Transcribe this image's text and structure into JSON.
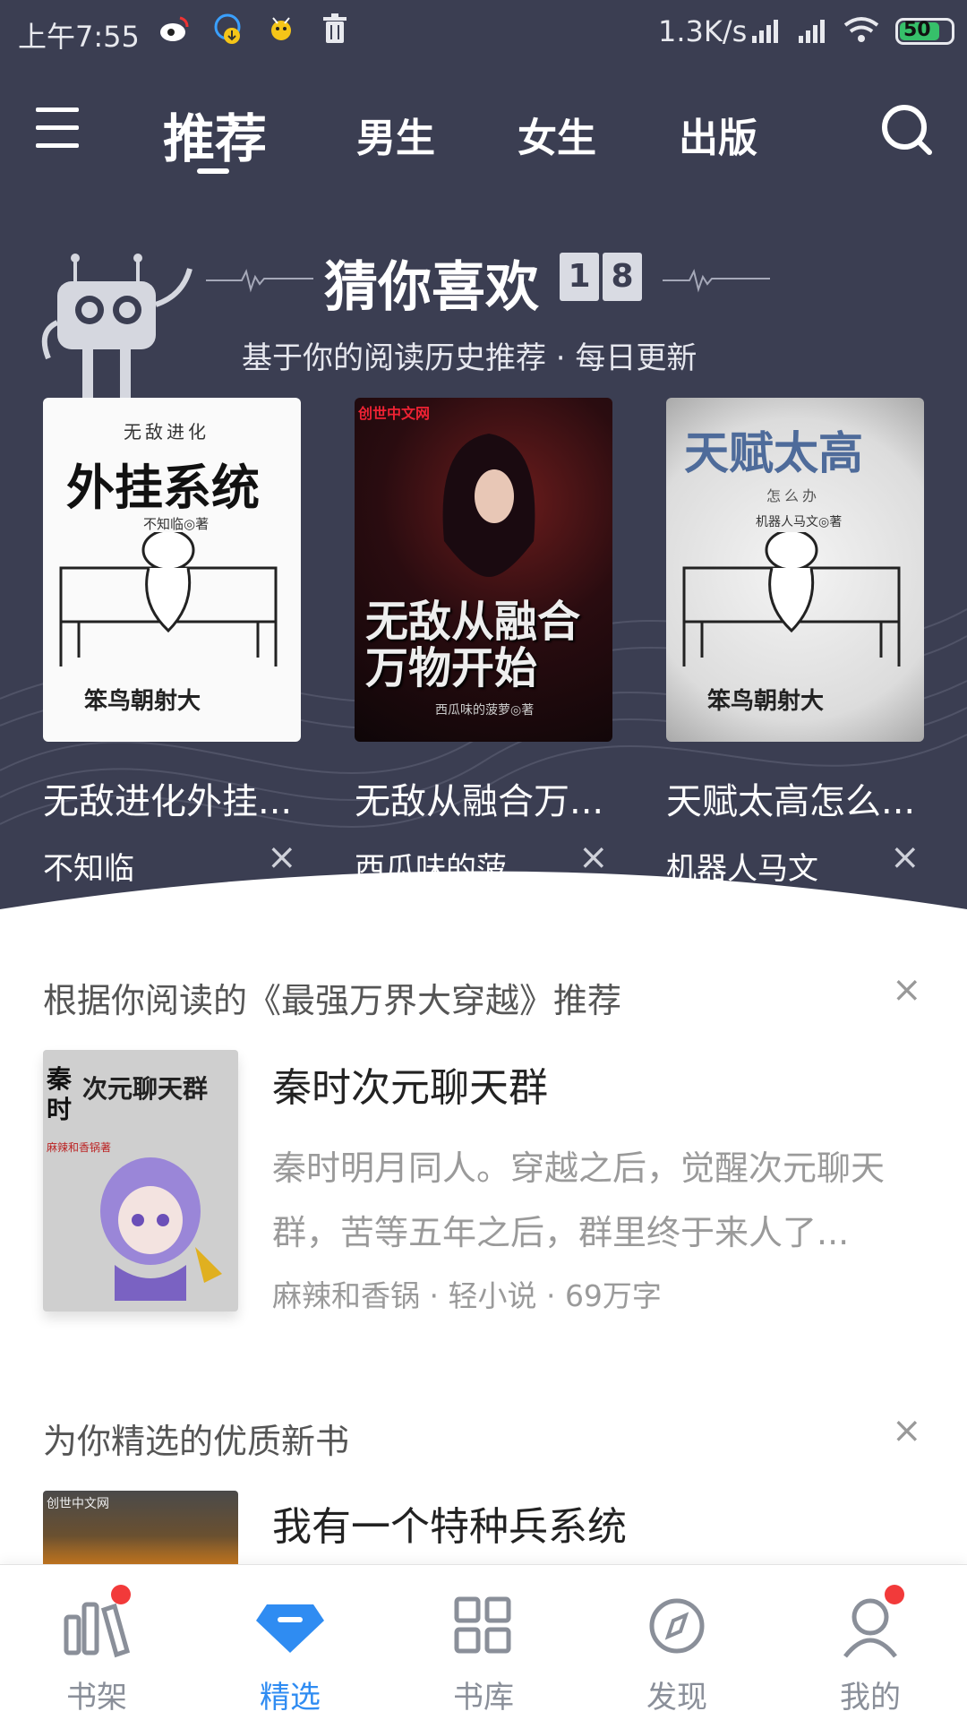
{
  "status_bar": {
    "time": "上午7:55",
    "speed": "1.3K/s",
    "battery": "50",
    "icons": [
      "weibo-icon",
      "download-icon",
      "bee-icon",
      "trash-icon",
      "signal-icon",
      "signal-icon",
      "wifi-icon",
      "battery-icon"
    ]
  },
  "nav": {
    "menu_icon": "menu-icon",
    "tabs": [
      {
        "label": "推荐",
        "active": true
      },
      {
        "label": "男生",
        "active": false
      },
      {
        "label": "女生",
        "active": false
      },
      {
        "label": "出版",
        "active": false
      }
    ],
    "search_icon": "search-icon"
  },
  "guess": {
    "title": "猜你喜欢",
    "date_digits": [
      "1",
      "8"
    ],
    "subtitle": "基于你的阅读历史推荐 · 每日更新",
    "books": [
      {
        "title": "无敌进化外挂...",
        "author": "不知临",
        "cover_tag": "无敌进化",
        "cover_title": "外挂系统",
        "cover_author": "不知临◎著"
      },
      {
        "title": "无敌从融合万...",
        "author": "西瓜味的菠...",
        "cover_logo": "创世中文网",
        "cover_line1": "无敌从融合",
        "cover_line2": "万物开始",
        "cover_author": "西瓜味的菠萝◎著"
      },
      {
        "title": "天赋太高怎么...",
        "author": "机器人马文",
        "cover_title": "天赋太高",
        "cover_sub": "怎么办",
        "cover_author": "机器人马文◎著"
      }
    ],
    "close_symbol": "×"
  },
  "recommend": {
    "heading": "根据你阅读的《最强万界大穿越》推荐",
    "close_symbol": "×",
    "book": {
      "title": "秦时次元聊天群",
      "description": "秦时明月同人。穿越之后，觉醒次元聊天群，苦等五年之后，群里终于来人了...",
      "meta": "麻辣和香锅 · 轻小说 · 69万字",
      "cover_a": "秦时",
      "cover_b": "次元聊天群",
      "cover_c": "麻辣和香锅著"
    }
  },
  "new_books": {
    "heading": "为你精选的优质新书",
    "close_symbol": "×",
    "book": {
      "title": "我有一个特种兵系统",
      "cover_logo": "创世中文网"
    }
  },
  "tabbar": {
    "tabs": [
      {
        "label": "书架",
        "icon": "bookshelf-icon",
        "active": false,
        "badge": true
      },
      {
        "label": "精选",
        "icon": "diamond-icon",
        "active": true,
        "badge": false
      },
      {
        "label": "书库",
        "icon": "grid-icon",
        "active": false,
        "badge": false
      },
      {
        "label": "发现",
        "icon": "compass-icon",
        "active": false,
        "badge": false
      },
      {
        "label": "我的",
        "icon": "person-icon",
        "active": false,
        "badge": true
      }
    ]
  },
  "colors": {
    "header_bg": "#3b3e52",
    "accent": "#2f8cf2",
    "badge": "#f23a3a",
    "muted_text": "#9a9a9a"
  }
}
